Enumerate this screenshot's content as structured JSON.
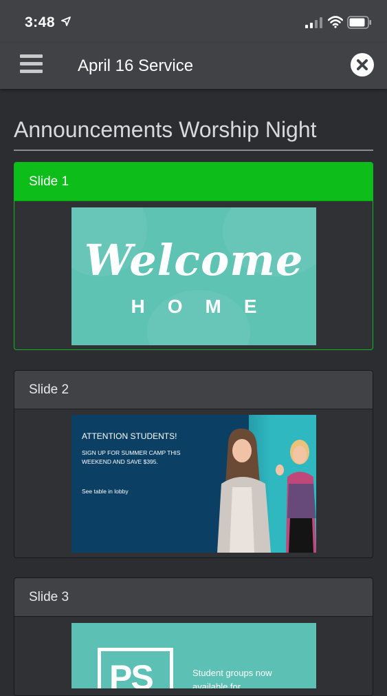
{
  "status_bar": {
    "time": "3:48",
    "icons": [
      "location-arrow-icon",
      "signal-icon",
      "wifi-icon",
      "battery-icon"
    ]
  },
  "nav": {
    "title": "April 16 Service",
    "menu_icon": "hamburger-menu-icon",
    "close_icon": "close-circle-icon"
  },
  "page": {
    "title": "Announcements Worship Night"
  },
  "slides": [
    {
      "label": "Slide 1",
      "active": true,
      "content": {
        "script": "Welcome",
        "sub": "HOME"
      }
    },
    {
      "label": "Slide 2",
      "active": false,
      "content": {
        "heading": "ATTENTION STUDENTS!",
        "body": "SIGN UP FOR SUMMER CAMP THIS WEEKEND AND SAVE $395.",
        "note": "See table in lobby"
      }
    },
    {
      "label": "Slide 3",
      "active": false,
      "content": {
        "logo": "PS",
        "text": "Student groups now available for"
      }
    }
  ],
  "colors": {
    "active_green": "#0dbe1b",
    "header_gray": "#404246",
    "background": "#2b2d31",
    "teal": "#5fc3b4",
    "navy": "#0b3f63"
  }
}
